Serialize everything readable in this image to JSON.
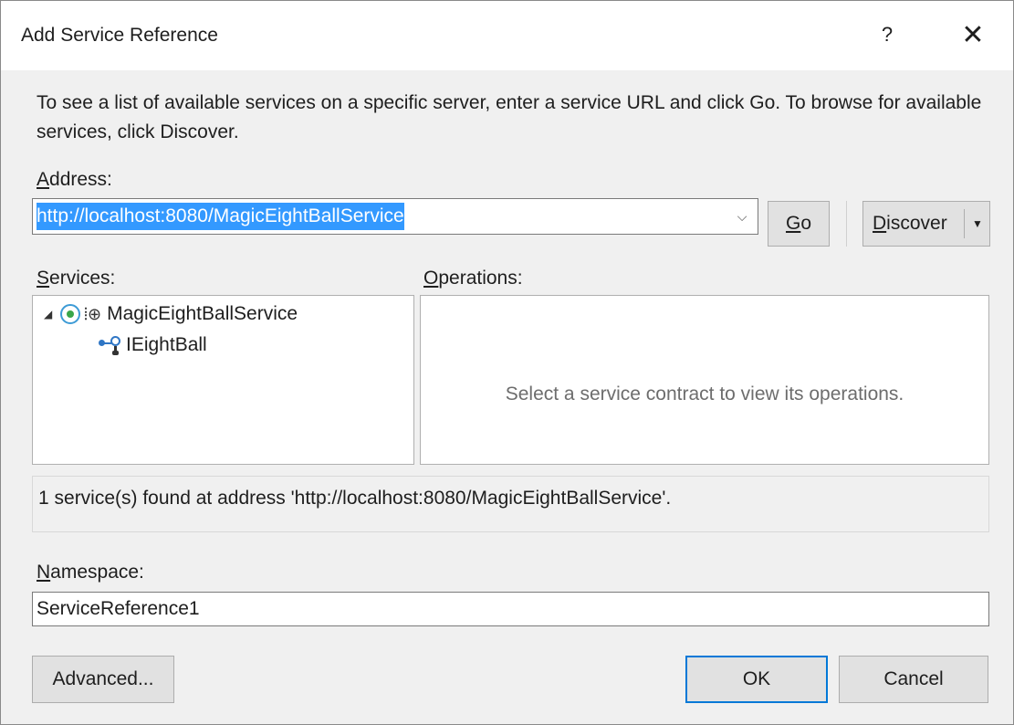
{
  "window": {
    "title": "Add Service Reference",
    "help_glyph": "?",
    "close_glyph": "✕"
  },
  "instructions": "To see a list of available services on a specific server, enter a service URL and click Go. To browse for available services, click Discover.",
  "address": {
    "label_mnemonic": "A",
    "label_rest": "ddress:",
    "value": "http://localhost:8080/MagicEightBallService",
    "dropdown_glyph": "⌵"
  },
  "buttons": {
    "go_mnemonic": "G",
    "go_rest": "o",
    "discover_mnemonic": "D",
    "discover_rest": "iscover",
    "discover_arrow": "▼",
    "advanced": "Advanced...",
    "ok": "OK",
    "cancel": "Cancel"
  },
  "services": {
    "label_mnemonic": "S",
    "label_rest": "ervices:",
    "tree": [
      {
        "label": "MagicEightBallService",
        "expander": "◢",
        "icon": "service-icon",
        "globe": "⦙⊕"
      },
      {
        "label": "IEightBall",
        "icon": "interface-icon"
      }
    ]
  },
  "operations": {
    "label_mnemonic": "O",
    "label_rest": "perations:",
    "empty_message": "Select a service contract to view its operations."
  },
  "status": "1 service(s) found at address 'http://localhost:8080/MagicEightBallService'.",
  "namespace": {
    "label_mnemonic": "N",
    "label_rest": "amespace:",
    "value": "ServiceReference1"
  },
  "colors": {
    "selection": "#3399ff",
    "default_button_border": "#0078d7",
    "dialog_bg": "#f0f0f0"
  }
}
